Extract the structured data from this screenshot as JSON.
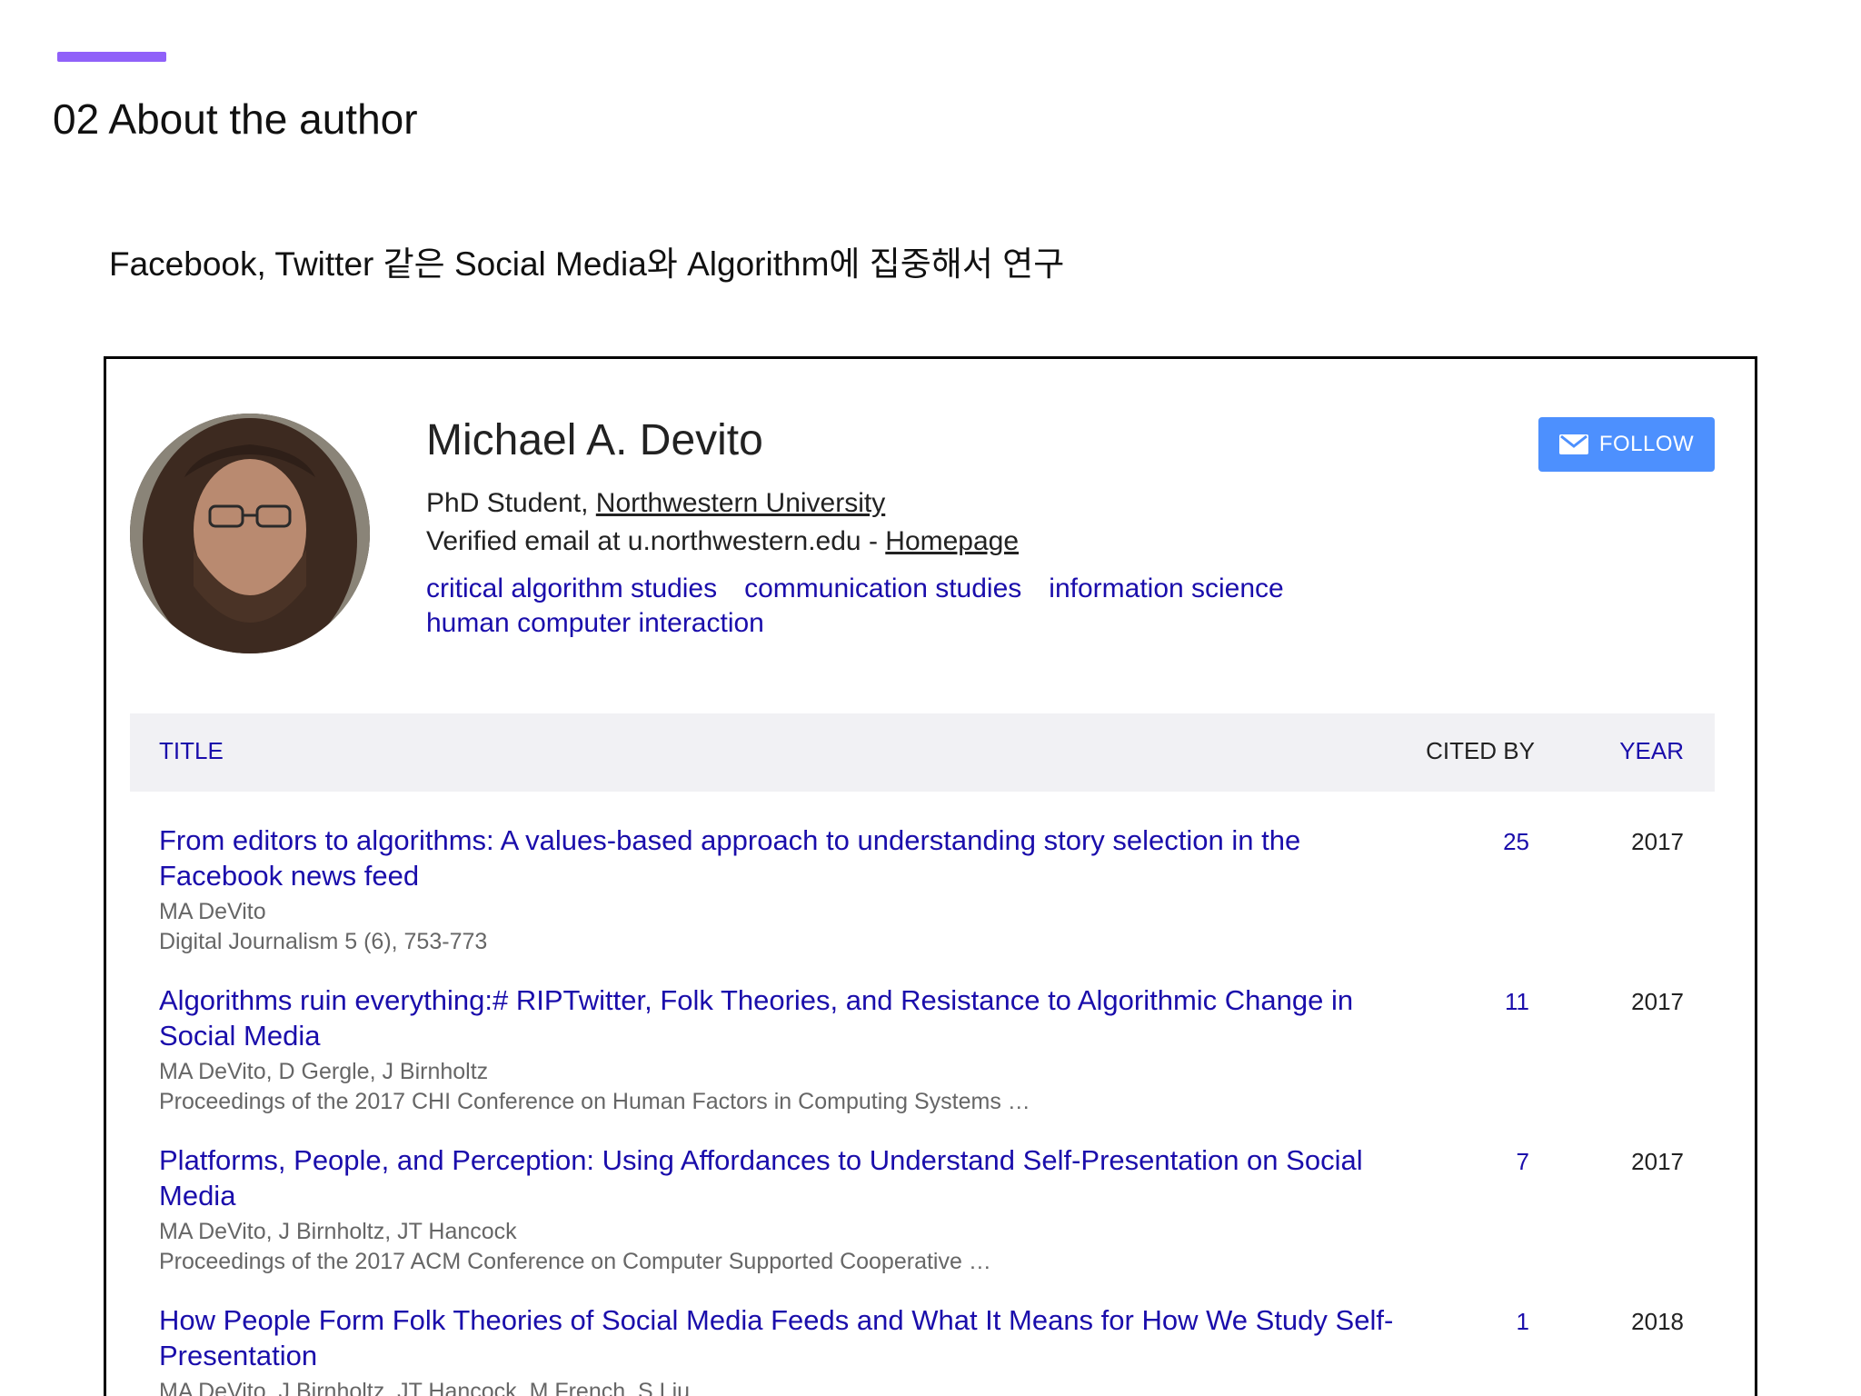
{
  "slide": {
    "title": "02 About the author",
    "subtitle": "Facebook, Twitter 같은 Social Media와 Algorithm에 집중해서 연구",
    "accent_color": "#9061f9"
  },
  "profile": {
    "name": "Michael A. Devito",
    "affiliation_prefix": "PhD Student, ",
    "affiliation_link": "Northwestern University",
    "email_text": "Verified email at u.northwestern.edu - ",
    "homepage_link": "Homepage",
    "follow_label": "FOLLOW",
    "follow_icon": "mail-icon",
    "tags": [
      "critical algorithm studies",
      "communication studies",
      "information science",
      "human computer interaction"
    ]
  },
  "table": {
    "headers": {
      "title": "TITLE",
      "cited_by": "CITED BY",
      "year": "YEAR"
    },
    "rows": [
      {
        "title": "From editors to algorithms: A values-based approach to understanding story selection in the Facebook news feed",
        "authors": "MA DeVito",
        "venue": "Digital Journalism 5 (6), 753-773",
        "cited_by": "25",
        "year": "2017"
      },
      {
        "title": "Algorithms ruin everything:# RIPTwitter, Folk Theories, and Resistance to Algorithmic Change in Social Media",
        "authors": "MA DeVito, D Gergle, J Birnholtz",
        "venue": "Proceedings of the 2017 CHI Conference on Human Factors in Computing Systems …",
        "cited_by": "11",
        "year": "2017"
      },
      {
        "title": "Platforms, People, and Perception: Using Affordances to Understand Self-Presentation on Social Media",
        "authors": "MA DeVito, J Birnholtz, JT Hancock",
        "venue": "Proceedings of the 2017 ACM Conference on Computer Supported Cooperative …",
        "cited_by": "7",
        "year": "2017"
      },
      {
        "title": "How People Form Folk Theories of Social Media Feeds and What It Means for How We Study Self-Presentation",
        "authors": "MA DeVito, J Birnholtz, JT Hancock, M French, S Liu",
        "venue": "",
        "cited_by": "1",
        "year": "2018"
      }
    ]
  }
}
